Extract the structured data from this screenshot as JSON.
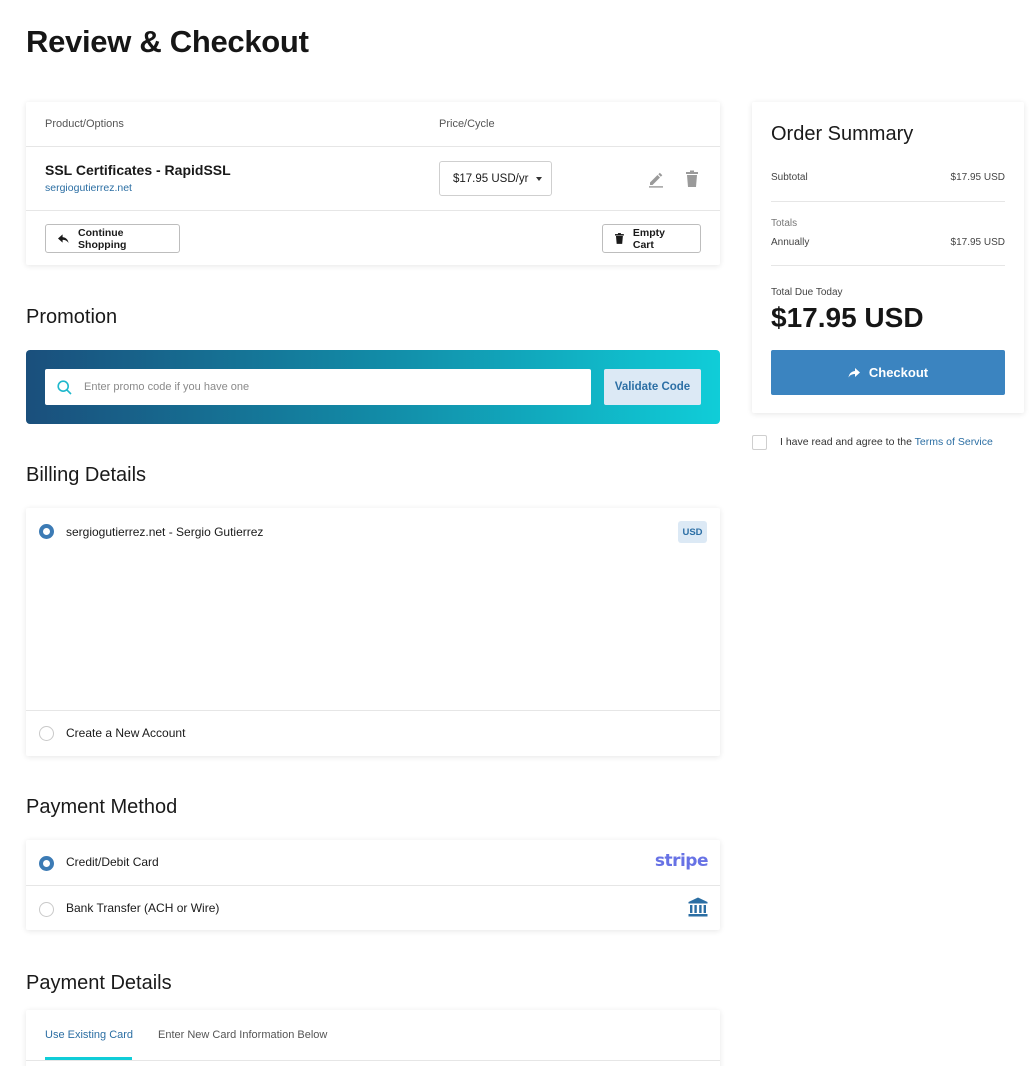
{
  "page": {
    "title": "Review & Checkout"
  },
  "cart": {
    "col_product": "Product/Options",
    "col_price": "Price/Cycle",
    "item": {
      "name": "SSL Certificates - RapidSSL",
      "domain": "sergiogutierrez.net",
      "cycle": "$17.95 USD/yr"
    },
    "continue_label": "Continue Shopping",
    "empty_label": "Empty Cart"
  },
  "promotion": {
    "title": "Promotion",
    "placeholder": "Enter promo code if you have one",
    "validate_label": "Validate Code"
  },
  "billing": {
    "title": "Billing Details",
    "existing_account": "sergiogutierrez.net - Sergio Gutierrez",
    "currency_badge": "USD",
    "new_account": "Create a New Account"
  },
  "payment_method": {
    "title": "Payment Method",
    "options": [
      {
        "label": "Credit/Debit Card",
        "brand": "stripe",
        "selected": true
      },
      {
        "label": "Bank Transfer (ACH or Wire)",
        "icon": "bank-icon",
        "selected": false
      }
    ]
  },
  "payment_details": {
    "title": "Payment Details",
    "tabs": [
      "Use Existing Card",
      "Enter New Card Information Below"
    ]
  },
  "summary": {
    "title": "Order Summary",
    "subtotal_label": "Subtotal",
    "subtotal_value": "$17.95 USD",
    "totals_label": "Totals",
    "annually_label": "Annually",
    "annually_value": "$17.95 USD",
    "due_label": "Total Due Today",
    "due_amount": "$17.95 USD",
    "checkout_label": "Checkout"
  },
  "tos": {
    "prefix": "I have read and agree to the ",
    "link": "Terms of Service"
  },
  "colors": {
    "accent": "#3b84c0",
    "link": "#2b6ea3",
    "teal": "#10cdd8",
    "stripe": "#6772e5"
  }
}
